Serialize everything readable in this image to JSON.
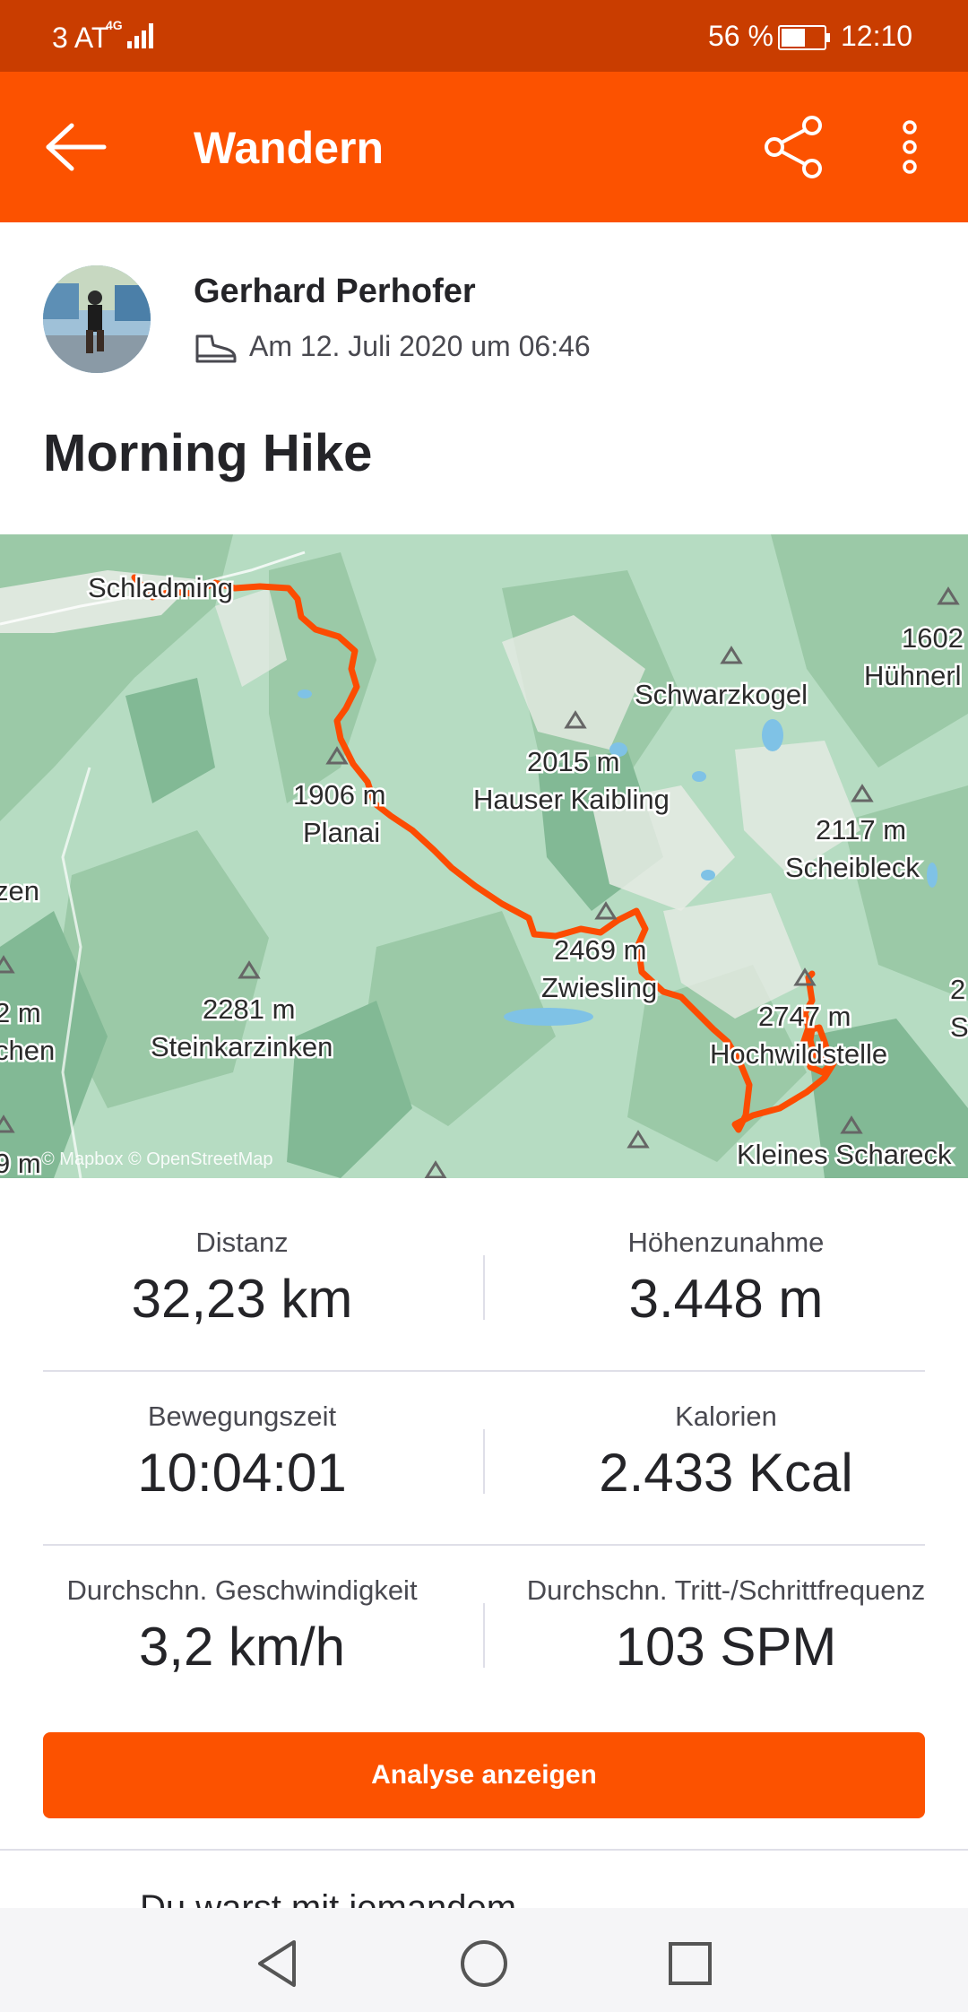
{
  "status_bar": {
    "carrier": "3 AT",
    "network": "4G",
    "battery": "56 %",
    "battery_level": 0.56,
    "time": "12:10"
  },
  "app_bar": {
    "title": "Wandern",
    "back_icon": "arrow-left-icon",
    "share_icon": "share-icon",
    "more_icon": "more-vertical-icon"
  },
  "athlete": {
    "name": "Gerhard Perhofer",
    "date": "Am 12. Juli 2020 um 06:46",
    "activity_icon": "hiking-shoe-icon"
  },
  "activity_title": "Morning Hike",
  "map": {
    "labels": {
      "schladming": "Schladming",
      "planai_h": "1906 m",
      "planai": "Planai",
      "hauser_h": "2015 m",
      "hauser": "Hauser Kaibling",
      "schwarzkogel": "Schwarzkogel",
      "h1602": "1602",
      "huehnerl": "Hühnerl",
      "scheibleck_h": "2117 m",
      "scheibleck": "Scheibleck",
      "zwiesling_h": "2469 m",
      "zwiesling": "Zwiesling",
      "steinkar_h": "2281 m",
      "steinkar": "Steinkarzinken",
      "hochwild_h": "2747 m",
      "hochwild": "Hochwildstelle",
      "schareck": "Kleines Schareck",
      "left_zen": "zen",
      "left_2m": "2 m",
      "left_chen": "chen",
      "right_2": "2",
      "right_s": "S",
      "left_9m": "9 m"
    },
    "attribution": "© Mapbox © OpenStreetMap",
    "route_color": "#fc4c02"
  },
  "stats": [
    {
      "label": "Distanz",
      "value": "32,23 km"
    },
    {
      "label": "Höhenzunahme",
      "value": "3.448 m"
    },
    {
      "label": "Bewegungszeit",
      "value": "10:04:01"
    },
    {
      "label": "Kalorien",
      "value": "2.433 Kcal"
    },
    {
      "label": "Durchschn. Geschwindigkeit",
      "value": "3,2 km/h"
    },
    {
      "label": "Durchschn. Tritt-/Schrittfrequenz",
      "value": "103 SPM"
    }
  ],
  "analyse_button": "Analyse anzeigen",
  "partial_text": "Du warst mit jemandem",
  "nav": {
    "back": "nav-back-icon",
    "home": "nav-home-icon",
    "recents": "nav-recents-icon"
  },
  "colors": {
    "brand": "#fc5200",
    "status_bar": "#c93d00"
  }
}
